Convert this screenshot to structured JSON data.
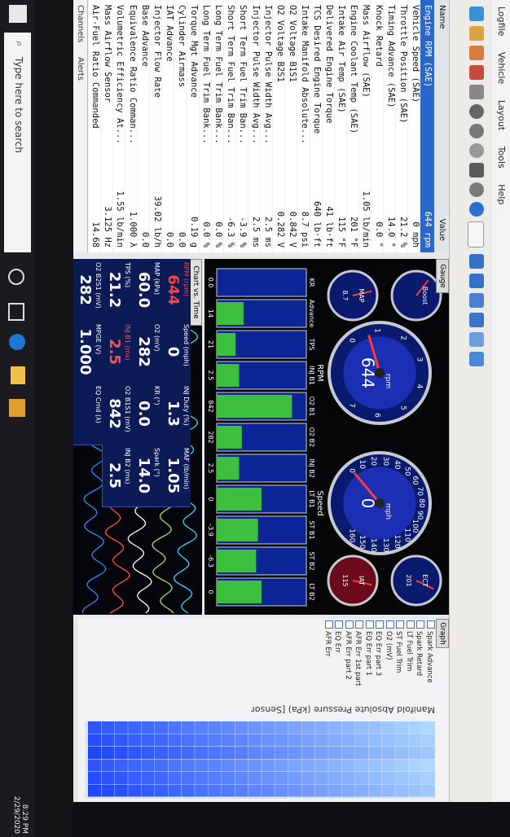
{
  "window": {
    "menu": [
      "Logfile",
      "Vehicle",
      "Layout",
      "Tools",
      "Help"
    ]
  },
  "pid_table": {
    "headers": {
      "name": "Name",
      "value": "Value"
    },
    "rows": [
      {
        "name": "Engine RPM (SAE)",
        "value": "644 rpm",
        "selected": true
      },
      {
        "name": "Vehicle Speed (SAE)",
        "value": "0 mph"
      },
      {
        "name": "Throttle Position (SAE)",
        "value": "21.2 %"
      },
      {
        "name": "Timing Advance (SAE)",
        "value": "14.0 °"
      },
      {
        "name": "Knock Retard",
        "value": "0.0 °"
      },
      {
        "name": "Mass Airflow (SAE)",
        "value": "1.05 lb/min"
      },
      {
        "name": "Engine Coolant Temp (SAE)",
        "value": "201 °F"
      },
      {
        "name": "Intake Air Temp (SAE)",
        "value": "115 °F"
      },
      {
        "name": "Delivered Engine Torque",
        "value": "41 lb·ft"
      },
      {
        "name": "TCS Desired Engine Torque",
        "value": "640 lb·ft"
      },
      {
        "name": "Intake Manifold Absolute...",
        "value": "8.7 psi"
      },
      {
        "name": "O2 Voltage B1S1",
        "value": "0.842 V"
      },
      {
        "name": "O2 Voltage B2S1",
        "value": "0.282 V"
      },
      {
        "name": "Injector Pulse Width Avg...",
        "value": "2.5 ms"
      },
      {
        "name": "Injector Pulse Width Avg...",
        "value": "2.5 ms"
      },
      {
        "name": "Short Term Fuel Trim Ban...",
        "value": "-3.9 %"
      },
      {
        "name": "Short Term Fuel Trim Ban...",
        "value": "-6.3 %"
      },
      {
        "name": "Long Term Fuel Trim Bank...",
        "value": "0.0 %"
      },
      {
        "name": "Long Term Fuel Trim Bank...",
        "value": "0.0 %"
      },
      {
        "name": "Torque Mgt Advance",
        "value": "0.19 g"
      },
      {
        "name": "Cylinder Airmass",
        "value": "0.0"
      },
      {
        "name": "IAT Advance",
        "value": "0.0"
      },
      {
        "name": "Injector Flow Rate",
        "value": "39.02 lb/h"
      },
      {
        "name": "Base Advance",
        "value": "0.0"
      },
      {
        "name": "Equivalence Ratio Comman...",
        "value": "1.000 λ"
      },
      {
        "name": "Volumetric Efficiency At...",
        "value": "1.55 lb/min"
      },
      {
        "name": "Mass Airflow Sensor",
        "value": "3.125 Hz"
      },
      {
        "name": "Air-Fuel Ratio Commanded",
        "value": "14.68"
      }
    ],
    "channels_label": "Channels",
    "alerts_label": "Alerts"
  },
  "gauge_panel": {
    "tab": "Gauge",
    "rpm": {
      "label": "RPM",
      "unit": "rpm",
      "value": "644",
      "ticks": [
        "0",
        "1",
        "2",
        "3",
        "4",
        "5",
        "6",
        "7"
      ],
      "reading": 0.644,
      "max": 7
    },
    "speed": {
      "label": "Speed",
      "unit": "mph",
      "value": "0",
      "ticks": [
        "0",
        "10",
        "20",
        "30",
        "40",
        "50",
        "60",
        "70",
        "80",
        "90",
        "100",
        "110",
        "120",
        "130",
        "140",
        "150",
        "160"
      ],
      "reading": 0,
      "max": 160
    },
    "small": [
      {
        "label": "Boost",
        "value": "",
        "reading": 0.3
      },
      {
        "label": "MAP",
        "value": "8.7",
        "reading": 0.45
      },
      {
        "label": "ECT",
        "value": "201",
        "reading": 0.6
      },
      {
        "label": "IAT",
        "value": "115",
        "reading": 0.55
      }
    ],
    "bars": [
      {
        "label": "KR",
        "value": "0.0",
        "fill": 0.0
      },
      {
        "label": "Advance",
        "value": "14",
        "fill": 0.3
      },
      {
        "label": "TPS",
        "value": "21",
        "fill": 0.21
      },
      {
        "label": "INJ B1",
        "value": "2.5",
        "fill": 0.25
      },
      {
        "label": "O2 B1",
        "value": "842",
        "fill": 0.84
      },
      {
        "label": "O2 B2",
        "value": "282",
        "fill": 0.28
      },
      {
        "label": "INJ B2",
        "value": "2.5",
        "fill": 0.25
      },
      {
        "label": "LT B1",
        "value": "0",
        "fill": 0.5
      },
      {
        "label": "ST B1",
        "value": "-3.9",
        "fill": 0.46
      },
      {
        "label": "ST B2",
        "value": "-6.3",
        "fill": 0.44
      },
      {
        "label": "LT B2",
        "value": "0",
        "fill": 0.5
      }
    ],
    "bar_scale": [
      "0",
      "45"
    ]
  },
  "chart_panel": {
    "tab": "Chart vs. Time",
    "readouts": [
      {
        "label": "RPM (rpm)",
        "value": "644",
        "color": "#ff4040"
      },
      {
        "label": "Speed (mph)",
        "value": "0",
        "color": "#ffffff"
      },
      {
        "label": "INJ Duty (%)",
        "value": "1.3",
        "color": "#ffffff"
      },
      {
        "label": "MAF (lb/min)",
        "value": "1.05",
        "color": "#ffffff"
      },
      {
        "label": "MAP (kPa)",
        "value": "60.0",
        "color": "#ffffff"
      },
      {
        "label": "O2 (mV)",
        "value": "282",
        "color": "#ffffff"
      },
      {
        "label": "KR (°)",
        "value": "0.0",
        "color": "#ffffff"
      },
      {
        "label": "Spark (°)",
        "value": "14.0",
        "color": "#ffffff"
      },
      {
        "label": "TPS (%)",
        "value": "21.2",
        "color": "#ffffff"
      },
      {
        "label": "INJ B1 (ms)",
        "value": "2.5",
        "color": "#ff5050"
      },
      {
        "label": "O2 B1S1 (mV)",
        "value": "842",
        "color": "#ffffff"
      },
      {
        "label": "INJ B2 (ms)",
        "value": "2.5",
        "color": "#ffffff"
      },
      {
        "label": "O2 B2S1 (mV)",
        "value": "282",
        "color": "#ffffff"
      },
      {
        "label": "MPGE (V)",
        "value": "1.000",
        "color": "#ffffff"
      },
      {
        "label": "EQ Cmd (λ)",
        "value": "",
        "color": "#ffffff"
      }
    ]
  },
  "graph_panel": {
    "tab": "Graph",
    "series": [
      "Spark Advance",
      "Spark Retard",
      "LT Fuel Trim",
      "ST Fuel Trim",
      "O2 (mV)",
      "EQ Err part 3",
      "EQ Err part 1",
      "AFR Err 1st part",
      "AFR Err part 2",
      "EQ Err",
      "AFR Err"
    ],
    "title": "Manifold Absolute Pressure (kPa) [Sensor"
  },
  "taskbar": {
    "search_placeholder": "Type here to search",
    "time": "8:29 PM",
    "date": "2/29/2020"
  }
}
